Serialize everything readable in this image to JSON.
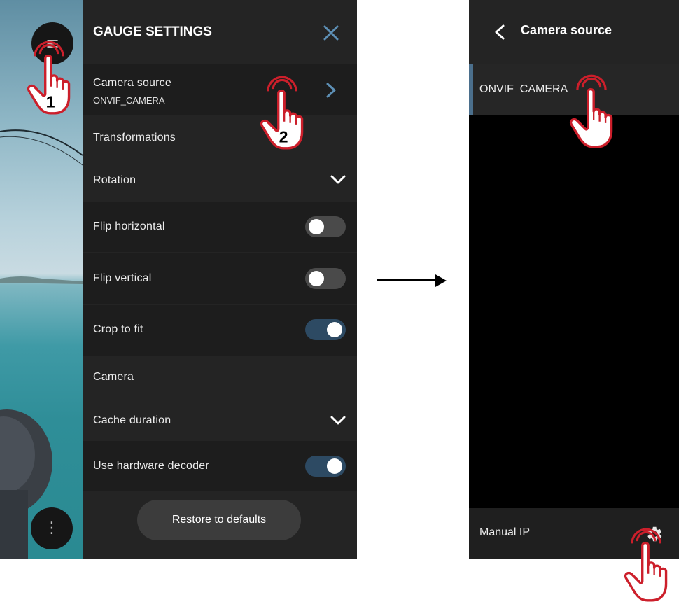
{
  "left_screen": {
    "fab_top_icon": "menu-icon",
    "fab_bottom_icon": "more-vertical-icon",
    "panel": {
      "title": "GAUGE SETTINGS",
      "close_icon": "close-icon",
      "camera_source": {
        "label": "Camera source",
        "value": "ONVIF_CAMERA",
        "icon": "chevron-right-icon"
      },
      "section_transformations": "Transformations",
      "rotation": {
        "label": "Rotation",
        "icon": "chevron-down-icon"
      },
      "flip_horizontal": {
        "label": "Flip horizontal",
        "on": false
      },
      "flip_vertical": {
        "label": "Flip vertical",
        "on": false
      },
      "crop_to_fit": {
        "label": "Crop to fit",
        "on": true
      },
      "section_camera": "Camera",
      "cache_duration": {
        "label": "Cache duration",
        "icon": "chevron-down-icon"
      },
      "hardware_decoder": {
        "label": "Use hardware decoder",
        "on": true
      },
      "restore_label": "Restore to defaults"
    }
  },
  "right_screen": {
    "back_icon": "chevron-left-icon",
    "title": "Camera source",
    "selected_item": "ONVIF_CAMERA",
    "footer_label": "Manual IP",
    "footer_icon": "gear-icon"
  },
  "annotations": {
    "step1": "1",
    "step2": "2",
    "hand_icon": "tap-hand-icon",
    "arrow_icon": "arrow-right-icon"
  },
  "colors": {
    "panel_bg": "#242424",
    "toggle_on": "#2d4a63",
    "accent": "#4b6f8c",
    "tap_red": "#cc1f2b",
    "chevron_blue": "#5d8fb5"
  }
}
